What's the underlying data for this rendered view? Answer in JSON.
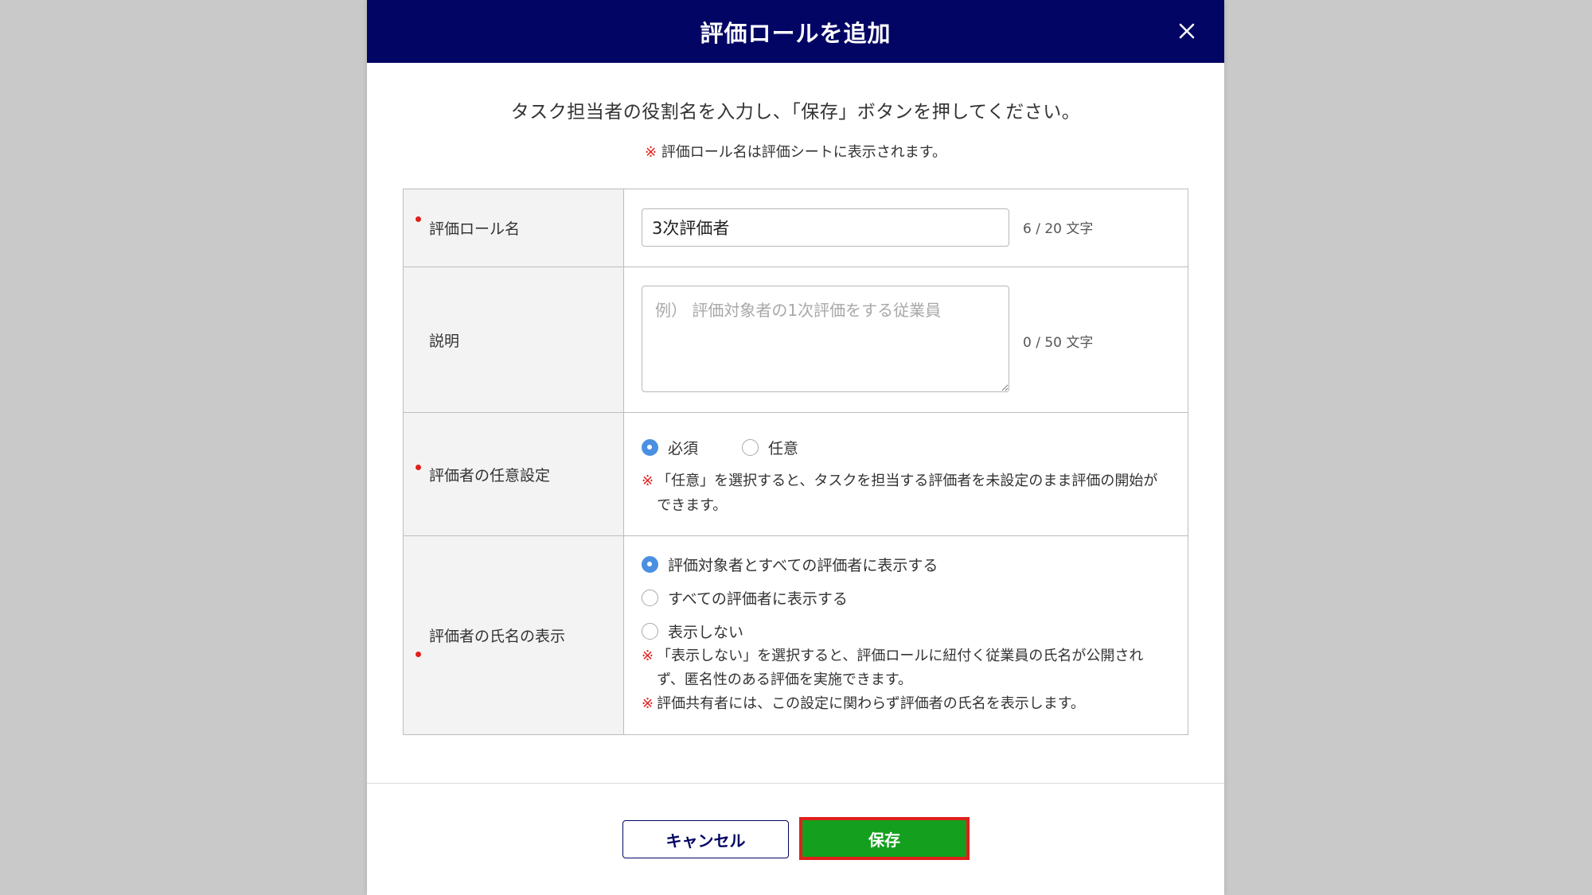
{
  "modal": {
    "title": "評価ロールを追加",
    "intro": "タスク担当者の役割名を入力し、「保存」ボタンを押してください。",
    "note_mark": "※",
    "note": "評価ロール名は評価シートに表示されます。"
  },
  "form": {
    "role_name": {
      "label": "評価ロール名",
      "value": "3次評価者",
      "counter": "6 / 20 文字"
    },
    "description": {
      "label": "説明",
      "placeholder": "例） 評価対象者の1次評価をする従業員",
      "counter": "0 / 50 文字"
    },
    "evaluator_optional": {
      "label": "評価者の任意設定",
      "options": [
        "必須",
        "任意"
      ],
      "selected": "必須",
      "note_mark": "※",
      "note": "「任意」を選択すると、タスクを担当する評価者を未設定のまま評価の開始ができます。"
    },
    "name_display": {
      "label": "評価者の氏名の表示",
      "options": [
        "評価対象者とすべての評価者に表示する",
        "すべての評価者に表示する",
        "表示しない"
      ],
      "selected": "評価対象者とすべての評価者に表示する",
      "note_mark": "※",
      "note1": "「表示しない」を選択すると、評価ロールに紐付く従業員の氏名が公開されず、匿名性のある評価を実施できます。",
      "note2": "評価共有者には、この設定に関わらず評価者の氏名を表示します。"
    }
  },
  "buttons": {
    "cancel": "キャンセル",
    "save": "保存"
  },
  "colors": {
    "header": "#020563",
    "save": "#14a01e",
    "highlight": "#e0201c",
    "radio_selected": "#4a90e2"
  },
  "icons": {
    "close": "close-icon"
  }
}
